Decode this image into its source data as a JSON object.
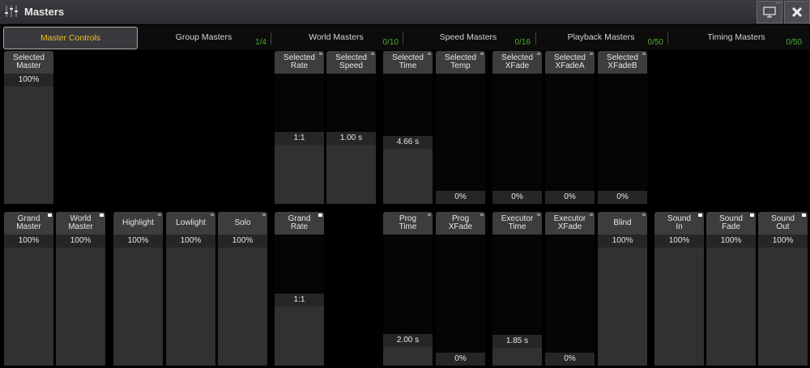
{
  "window": {
    "title": "Masters"
  },
  "tabs": [
    {
      "label": "Master Controls",
      "count": ""
    },
    {
      "label": "Group Masters",
      "count": "1/4"
    },
    {
      "label": "World Masters",
      "count": "0/10"
    },
    {
      "label": "Speed Masters",
      "count": "0/16"
    },
    {
      "label": "Playback Masters",
      "count": "0/50"
    },
    {
      "label": "Timing Masters",
      "count": "0/50"
    }
  ],
  "row1": [
    {
      "label": "Selected\nMaster",
      "value": "100%",
      "level": 1.0
    },
    {
      "label": "Selected\nRate",
      "value": "1:1",
      "level": 0.5
    },
    {
      "label": "Selected\nSpeed",
      "value": "1.00 s",
      "level": 0.5
    },
    {
      "label": "Selected\nTime",
      "value": "4.66 s",
      "level": 0.47
    },
    {
      "label": "Selected\nTemp",
      "value": "0%",
      "level": 0
    },
    {
      "label": "Selected\nXFade",
      "value": "0%",
      "level": 0
    },
    {
      "label": "Selected\nXFadeA",
      "value": "0%",
      "level": 0
    },
    {
      "label": "Selected\nXFadeB",
      "value": "0%",
      "level": 0
    }
  ],
  "row2": [
    {
      "label": "Grand\nMaster",
      "value": "100%",
      "level": 1.0
    },
    {
      "label": "World\nMaster",
      "value": "100%",
      "level": 1.0
    },
    {
      "label": "Highlight",
      "value": "100%",
      "level": 1.0
    },
    {
      "label": "Lowlight",
      "value": "100%",
      "level": 1.0
    },
    {
      "label": "Solo",
      "value": "100%",
      "level": 1.0
    },
    {
      "label": "Grand\nRate",
      "value": "1:1",
      "level": 0.5
    },
    {
      "label": "Prog\nTime",
      "value": "2.00 s",
      "level": 0.16
    },
    {
      "label": "Prog\nXFade",
      "value": "0%",
      "level": 0
    },
    {
      "label": "Executor\nTime",
      "value": "1.85 s",
      "level": 0.15
    },
    {
      "label": "Executor\nXFade",
      "value": "0%",
      "level": 0
    },
    {
      "label": "Blind",
      "value": "100%",
      "level": 1.0
    },
    {
      "label": "Sound\nIn",
      "value": "100%",
      "level": 1.0
    },
    {
      "label": "Sound\nFade",
      "value": "100%",
      "level": 1.0
    },
    {
      "label": "Sound\nOut",
      "value": "100%",
      "level": 1.0
    }
  ]
}
